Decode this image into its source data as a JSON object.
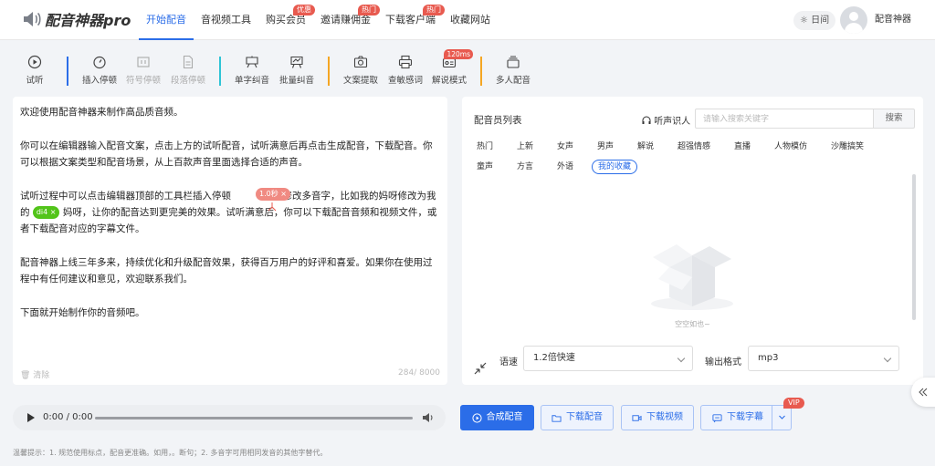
{
  "app": {
    "logo_text": "配音神器pro"
  },
  "nav": {
    "items": [
      {
        "label": "开始配音",
        "active": true,
        "badge": ""
      },
      {
        "label": "音视频工具",
        "active": false,
        "badge": ""
      },
      {
        "label": "购买会员",
        "active": false,
        "badge": "优惠"
      },
      {
        "label": "邀请赚佣金",
        "active": false,
        "badge": "热门"
      },
      {
        "label": "下载客户端",
        "active": false,
        "badge": "热门"
      },
      {
        "label": "收藏网站",
        "active": false,
        "badge": ""
      }
    ],
    "theme_label": "☼ 日间",
    "user_name": "配音神器"
  },
  "toolbar": {
    "listen": "试听",
    "insert_pause": "插入停顿",
    "symbol_pause": "符号停顿",
    "paragraph_pause": "段落停顿",
    "single_correct": "单字纠音",
    "batch_correct": "批量纠音",
    "text_extract": "文案提取",
    "sensitive_check": "查敏感词",
    "narrate_mode": "解说模式",
    "narrate_badge": "120ms",
    "multi_voice": "多人配音"
  },
  "editor": {
    "p1": "欢迎使用配音神器来制作高品质音频。",
    "p2": "你可以在编辑器输入配音文案，点击上方的试听配音，试听满意后再点击生成配音，下载配音。你可以根据文案类型和配音场景，从上百款声音里面选择合适的声音。",
    "p3a": "试听过程中可以点击编辑器顶部的工具栏插入停顿",
    "p3b": "，修改多音字，比如我的妈呀修改为我的",
    "p3c": "妈呀，让你的配音达到更完美的效果。试听满意后，你可以下载配音音频和视频文件，或者下载配音对应的字幕文件。",
    "pause_tag": "1.0秒 ×",
    "poly_tag": "di4 ×",
    "p4": "配音神器上线三年多来，持续优化和升级配音效果，获得百万用户的好评和喜爱。如果你在使用过程中有任何建议和意见，欢迎联系我们。",
    "p5": "下面就开始制作你的音频吧。",
    "clear": "清除",
    "char_count": "284/ 8000"
  },
  "voice_panel": {
    "title": "配音员列表",
    "listen_id": "听声识人",
    "search_placeholder": "请输入搜索关键字",
    "search_button": "搜索",
    "categories_row1": [
      "热门",
      "上新",
      "女声",
      "男声",
      "解说",
      "超强情感",
      "直播",
      "人物模仿",
      "沙雕搞笑"
    ],
    "categories_row2": [
      "童声",
      "方言",
      "外语",
      "我的收藏"
    ],
    "active_category": "我的收藏",
    "empty_text": "空空如也~",
    "speed_label": "语速",
    "speed_value": "1.2倍快速",
    "format_label": "输出格式",
    "format_value": "mp3"
  },
  "player": {
    "time": "0:00 / 0:00"
  },
  "actions": {
    "synthesize": "合成配音",
    "download_audio": "下载配音",
    "download_video": "下载视频",
    "download_subtitle": "下载字幕",
    "vip_badge": "VIP"
  },
  "hint": "温馨提示：1. 规范使用标点，配音更准确。如用，。断句；2. 多音字可用相同发音的其他字替代。",
  "colors": {
    "accent": "#2b6de8",
    "badge": "#e85a4f",
    "green": "#52c41a"
  }
}
